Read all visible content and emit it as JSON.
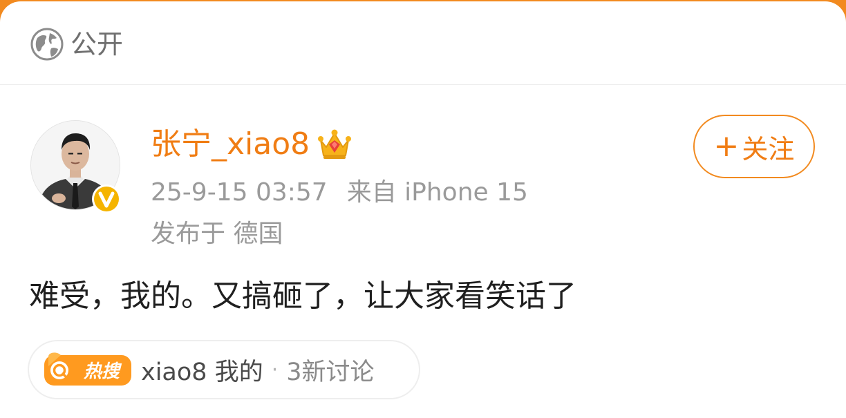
{
  "visibility": {
    "icon": "globe-icon",
    "label": "公开"
  },
  "post": {
    "author": {
      "name": "张宁_xiao8",
      "badge_icon": "crown-icon",
      "verified_icon": "verified-v-icon"
    },
    "timestamp": "25-9-15 03:57",
    "source": "来自 iPhone 15",
    "location": "发布于 德国",
    "content": "难受，我的。又搞砸了，让大家看笑话了"
  },
  "follow_button": {
    "icon": "plus-icon",
    "label": "关注"
  },
  "hot_topic": {
    "badge_label": "热搜",
    "badge_icon": "search-icon",
    "topic": "xiao8 我的",
    "separator": "·",
    "discussion_count": "3新讨论"
  },
  "colors": {
    "accent_orange": "#f07d14",
    "frame_orange": "#f28a1f",
    "hot_badge_orange": "#ff9a1f",
    "verified_yellow": "#f5b400"
  }
}
